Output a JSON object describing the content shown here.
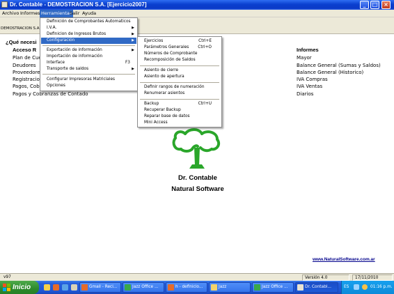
{
  "window": {
    "title": "Dr. Contable - DEMOSTRACION S.A.  [Ejercicio2007]",
    "controls": [
      "minimize",
      "maximize",
      "close"
    ]
  },
  "menubar": {
    "items": [
      "Archivo",
      "Informes",
      "Herramientas",
      "Salir",
      "Ayuda"
    ],
    "open": "Herramientas"
  },
  "company_name": "DEMOSTRACION S.A.",
  "main": {
    "question": "¿Qué necesi",
    "acceso_rapido": {
      "heading": "Acceso R",
      "links": [
        "Plan de Cue",
        "Deudores",
        "Proveedore",
        "Registracio",
        "Pagos, Cob",
        "Pagos y Cobranzas de Contado"
      ]
    },
    "informes": {
      "heading": "Informes",
      "links": [
        "Mayor",
        "Balance General (Sumas y Saldos)",
        "Balance General (Historico)",
        "IVA Compras",
        "IVA Ventas",
        "Diarios"
      ]
    },
    "brand_name": "Dr. Contable",
    "brand_tagline": "Natural Software",
    "website": "www.NaturalSoftware.com.ar"
  },
  "herramientas_menu": {
    "items": [
      {
        "label": "Definición de Comprobantes Automaticos"
      },
      {
        "label": "I.V.A.",
        "submenu": true
      },
      {
        "label": "Definicion de Ingresos Brutos",
        "submenu": true
      },
      {
        "label": "Configuración",
        "submenu": true,
        "highlighted": true
      },
      {
        "separator": true
      },
      {
        "label": "Exportación de información",
        "submenu": true
      },
      {
        "label": "Importación de información"
      },
      {
        "label": "Interface",
        "shortcut": "F3"
      },
      {
        "label": "Transporte de saldos",
        "submenu": true
      },
      {
        "separator": true
      },
      {
        "label": "Configurar Impresoras Matriciales"
      },
      {
        "label": "Opciones"
      }
    ]
  },
  "configuracion_submenu": {
    "items": [
      {
        "label": "Ejercicios",
        "shortcut": "Ctrl+E"
      },
      {
        "label": "Parámetros Generales",
        "shortcut": "Ctrl+O"
      },
      {
        "label": "Números de Comprobante"
      },
      {
        "label": "Recomposición de Saldos"
      },
      {
        "separator": true
      },
      {
        "label": "Asiento de cierre"
      },
      {
        "label": "Asiento de apertura"
      },
      {
        "separator": true
      },
      {
        "label": "Definir rangos de numeración"
      },
      {
        "label": "Renumerar asientos"
      },
      {
        "separator": true
      },
      {
        "label": "Backup",
        "shortcut": "Ctrl+U"
      },
      {
        "label": "Recuperar Backup"
      },
      {
        "label": "Reparar base de datos"
      },
      {
        "label": "Mini Access"
      }
    ]
  },
  "statusbar": {
    "left": "v97",
    "version": "Versión 4.0",
    "date": "17/11/2010"
  },
  "taskbar": {
    "start_label": "Inicio",
    "tasks": [
      {
        "label": "Gmail - Reci...",
        "icon": "browser-icon"
      },
      {
        "label": "Jazz Office ...",
        "icon": "jazz-icon"
      },
      {
        "label": "h - definicio...",
        "icon": "browser-icon"
      },
      {
        "label": "Jazz",
        "icon": "folder-icon"
      },
      {
        "label": "Jazz Office ...",
        "icon": "jazz-icon"
      },
      {
        "label": "Dr. Contabl...",
        "icon": "app-icon",
        "active": true
      }
    ],
    "language": "ES",
    "clock": "01:16 p.m."
  },
  "colors": {
    "titlebar": "#0a3fcf",
    "menu_highlight": "#316ac5",
    "tree_green": "#2aa62a",
    "link_blue": "#00008b",
    "start_green": "#2d8a2c"
  }
}
